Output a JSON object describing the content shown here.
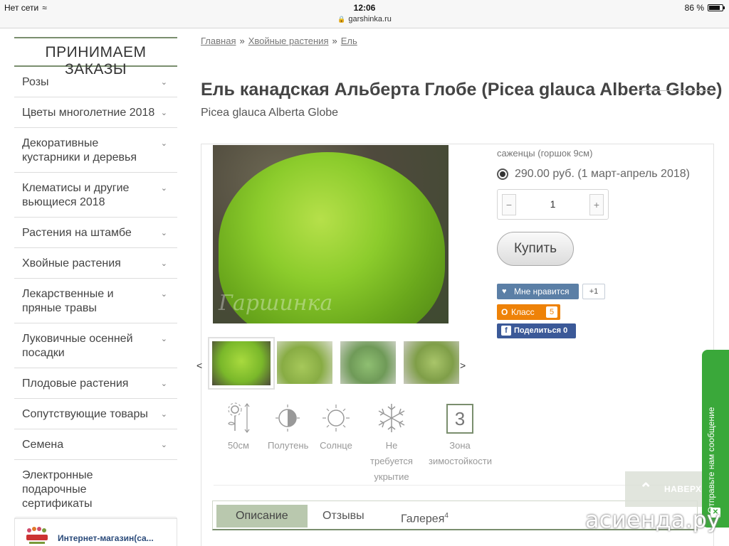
{
  "status_bar": {
    "network": "Нет сети",
    "time": "12:06",
    "url": "garshinka.ru",
    "battery": "86 %",
    "battery_level": 0.86
  },
  "sidebar": {
    "heading": "ПРИНИМАЕМ ЗАКАЗЫ",
    "items": [
      {
        "label": "Розы"
      },
      {
        "label": "Цветы многолетние 2018"
      },
      {
        "label": "Декоративные кустарники и деревья"
      },
      {
        "label": "Клематисы и другие вьющиеся 2018"
      },
      {
        "label": "Растения на штамбе"
      },
      {
        "label": "Хвойные растения"
      },
      {
        "label": "Лекарственные и пряные травы"
      },
      {
        "label": "Луковичные осенней посадки"
      },
      {
        "label": "Плодовые растения"
      },
      {
        "label": "Сопутствующие товары"
      },
      {
        "label": "Семена"
      },
      {
        "label": "Электронные подарочные сертификаты"
      }
    ],
    "shop_name": "Интернет-магазин(са..."
  },
  "breadcrumb": {
    "items": [
      "Главная",
      "Хвойные растения",
      "Ель"
    ],
    "separator": "»"
  },
  "product": {
    "title": "Ель канадская Альберта Глобе (Picea glauca Alberta Globe)",
    "subtitle": "Picea glauca Alberta Globe",
    "photo_watermark": "Гаршинка",
    "variant_label": "саженцы (горшок 9см)",
    "price_option": "290.00 руб. (1 март-апрель 2018)",
    "quantity": "1",
    "minus": "−",
    "plus": "+",
    "buy_label": "Купить",
    "thumb_prev": "<",
    "thumb_next": ">"
  },
  "features": [
    {
      "label": "50см",
      "icon": "plant-height-icon"
    },
    {
      "label": "Полутень",
      "icon": "half-shade-icon"
    },
    {
      "label": "Солнце",
      "icon": "sun-icon"
    },
    {
      "label": "Не требуется укрытие",
      "icon": "snowflake-icon"
    },
    {
      "label": "Зона зимостойкости",
      "icon": "zone-icon",
      "value": "3"
    }
  ],
  "social": {
    "vk_label": "Мне нравится",
    "vk_count": "+1",
    "ok_label": "Класс",
    "ok_count": "5",
    "fb_label": "Поделиться",
    "fb_count": "0"
  },
  "tabs": [
    {
      "label": "Описание",
      "active": true
    },
    {
      "label": "Отзывы",
      "active": false
    },
    {
      "label": "Галерея",
      "sup": "4",
      "active": false
    }
  ],
  "widgets": {
    "to_top": "НАВЕРХ",
    "feedback": "Отправьте нам сообщение",
    "site_watermark": "асиенда.ру"
  },
  "colors": {
    "accent": "#7a8e6e",
    "tab_active": "#b9c8ae",
    "vk": "#5b7fa6",
    "ok": "#ee8208",
    "fb": "#3b5998",
    "feedback": "#3aa83a"
  }
}
